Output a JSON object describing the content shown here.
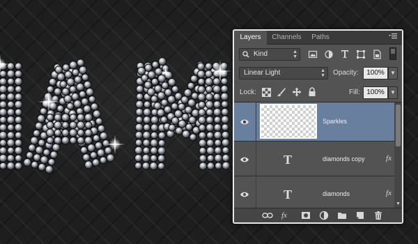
{
  "canvas": {
    "text_fragments": [
      "I",
      "A",
      "M"
    ]
  },
  "panel": {
    "tabs": [
      {
        "label": "Layers",
        "active": true
      },
      {
        "label": "Channels",
        "active": false
      },
      {
        "label": "Paths",
        "active": false
      }
    ],
    "panel_menu_icon": "panel-menu-icon",
    "filter": {
      "kind_label": "Kind",
      "icons": [
        "pixel-filter-icon",
        "adjustment-filter-icon",
        "type-filter-icon",
        "shape-filter-icon",
        "smart-object-filter-icon"
      ]
    },
    "blend_mode": "Linear Light",
    "opacity_label": "Opacity:",
    "opacity_value": "100%",
    "lock_label": "Lock:",
    "fill_label": "Fill:",
    "fill_value": "100%",
    "layers": [
      {
        "name": "Sparkles",
        "kind": "pixel",
        "selected": true,
        "visible": true,
        "has_fx": false
      },
      {
        "name": "diamonds copy",
        "kind": "type",
        "selected": false,
        "visible": true,
        "has_fx": true
      },
      {
        "name": "diamonds",
        "kind": "type",
        "selected": false,
        "visible": true,
        "has_fx": true
      }
    ],
    "type_glyph": "T",
    "fx_glyph": "fx",
    "footer_icons": [
      "link-layers-icon",
      "add-style-icon",
      "add-mask-icon",
      "adjustment-layer-icon",
      "new-group-icon",
      "new-layer-icon",
      "delete-layer-icon"
    ],
    "footer_fx_label": "fx",
    "colors": {
      "panel_bg": "#535353",
      "selected_row": "#687f9e",
      "tab_bar": "#3a3a3a"
    }
  }
}
